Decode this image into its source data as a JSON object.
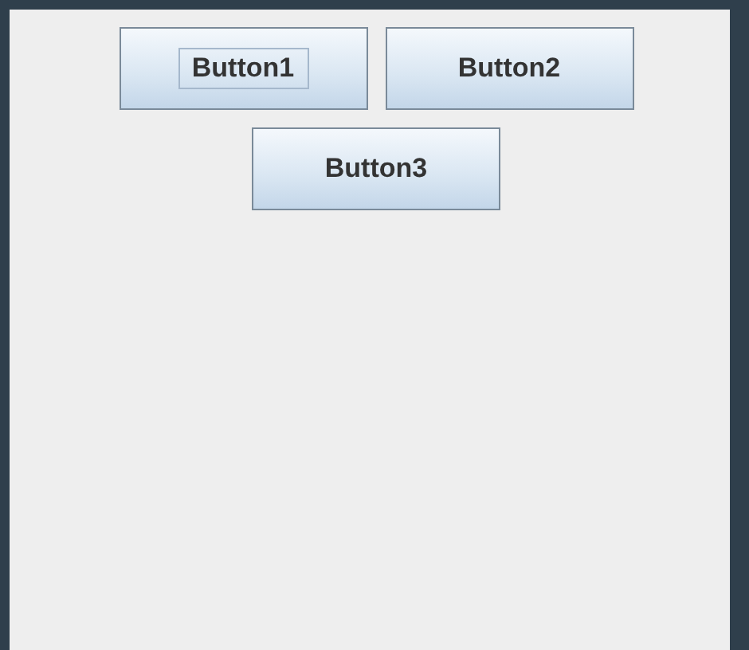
{
  "buttons": [
    {
      "label": "Button1",
      "focused": true
    },
    {
      "label": "Button2",
      "focused": false
    },
    {
      "label": "Button3",
      "focused": false
    }
  ]
}
